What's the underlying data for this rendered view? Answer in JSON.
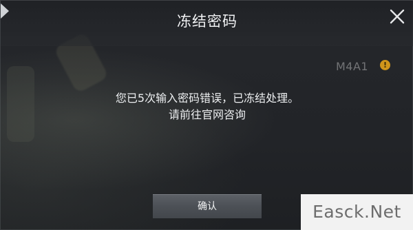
{
  "dialog": {
    "title": "冻结密码",
    "message_line1": "您已5次输入密码错误，已冻结处理。",
    "message_line2": "请前往官网咨询",
    "confirm_label": "确认"
  },
  "background": {
    "weapon_label": "M4A1",
    "warning_mark": "!"
  },
  "watermark": "Easck.Net",
  "icons": {
    "close": "close-icon",
    "corner": "triangle-icon"
  },
  "colors": {
    "dialog_bg": "#24262a",
    "button_bg": "#4c5056",
    "warning": "#e3a21a"
  }
}
